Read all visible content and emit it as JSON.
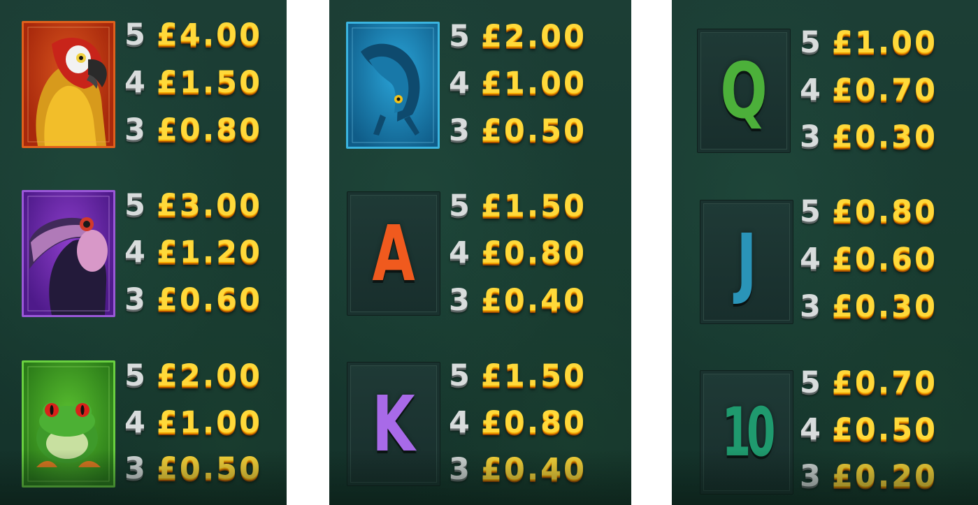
{
  "paytable": {
    "panels": [
      {
        "symbols": [
          {
            "symbol_icon": "parrot-icon",
            "tile_color": "#c23a12",
            "payouts": [
              {
                "count": "5",
                "amount": "£4.00"
              },
              {
                "count": "4",
                "amount": "£1.50"
              },
              {
                "count": "3",
                "amount": "£0.80"
              }
            ]
          },
          {
            "symbol_icon": "toucan-icon",
            "tile_color": "#6a2ca6",
            "payouts": [
              {
                "count": "5",
                "amount": "£3.00"
              },
              {
                "count": "4",
                "amount": "£1.20"
              },
              {
                "count": "3",
                "amount": "£0.60"
              }
            ]
          },
          {
            "symbol_icon": "frog-icon",
            "tile_color": "#3aa028",
            "payouts": [
              {
                "count": "5",
                "amount": "£2.00"
              },
              {
                "count": "4",
                "amount": "£1.00"
              },
              {
                "count": "3",
                "amount": "£0.50"
              }
            ]
          }
        ]
      },
      {
        "symbols": [
          {
            "symbol_icon": "salamander-icon",
            "tile_color": "#1e84b8",
            "payouts": [
              {
                "count": "5",
                "amount": "£2.00"
              },
              {
                "count": "4",
                "amount": "£1.00"
              },
              {
                "count": "3",
                "amount": "£0.50"
              }
            ]
          },
          {
            "symbol_icon": "letter-a-icon",
            "letter": "A",
            "letter_color": "#f05a1e",
            "payouts": [
              {
                "count": "5",
                "amount": "£1.50"
              },
              {
                "count": "4",
                "amount": "£0.80"
              },
              {
                "count": "3",
                "amount": "£0.40"
              }
            ]
          },
          {
            "symbol_icon": "letter-k-icon",
            "letter": "K",
            "letter_color": "#a86ae8",
            "payouts": [
              {
                "count": "5",
                "amount": "£1.50"
              },
              {
                "count": "4",
                "amount": "£0.80"
              },
              {
                "count": "3",
                "amount": "£0.40"
              }
            ]
          }
        ]
      },
      {
        "symbols": [
          {
            "symbol_icon": "letter-q-icon",
            "letter": "Q",
            "letter_color": "#4cb03a",
            "payouts": [
              {
                "count": "5",
                "amount": "£1.00"
              },
              {
                "count": "4",
                "amount": "£0.70"
              },
              {
                "count": "3",
                "amount": "£0.30"
              }
            ]
          },
          {
            "symbol_icon": "letter-j-icon",
            "letter": "J",
            "letter_color": "#2a94b8",
            "payouts": [
              {
                "count": "5",
                "amount": "£0.80"
              },
              {
                "count": "4",
                "amount": "£0.60"
              },
              {
                "count": "3",
                "amount": "£0.30"
              }
            ]
          },
          {
            "symbol_icon": "number-10-icon",
            "letter": "10",
            "letter_color": "#1f9a6e",
            "payouts": [
              {
                "count": "5",
                "amount": "£0.70"
              },
              {
                "count": "4",
                "amount": "£0.50"
              },
              {
                "count": "3",
                "amount": "£0.20"
              }
            ]
          }
        ]
      }
    ]
  }
}
